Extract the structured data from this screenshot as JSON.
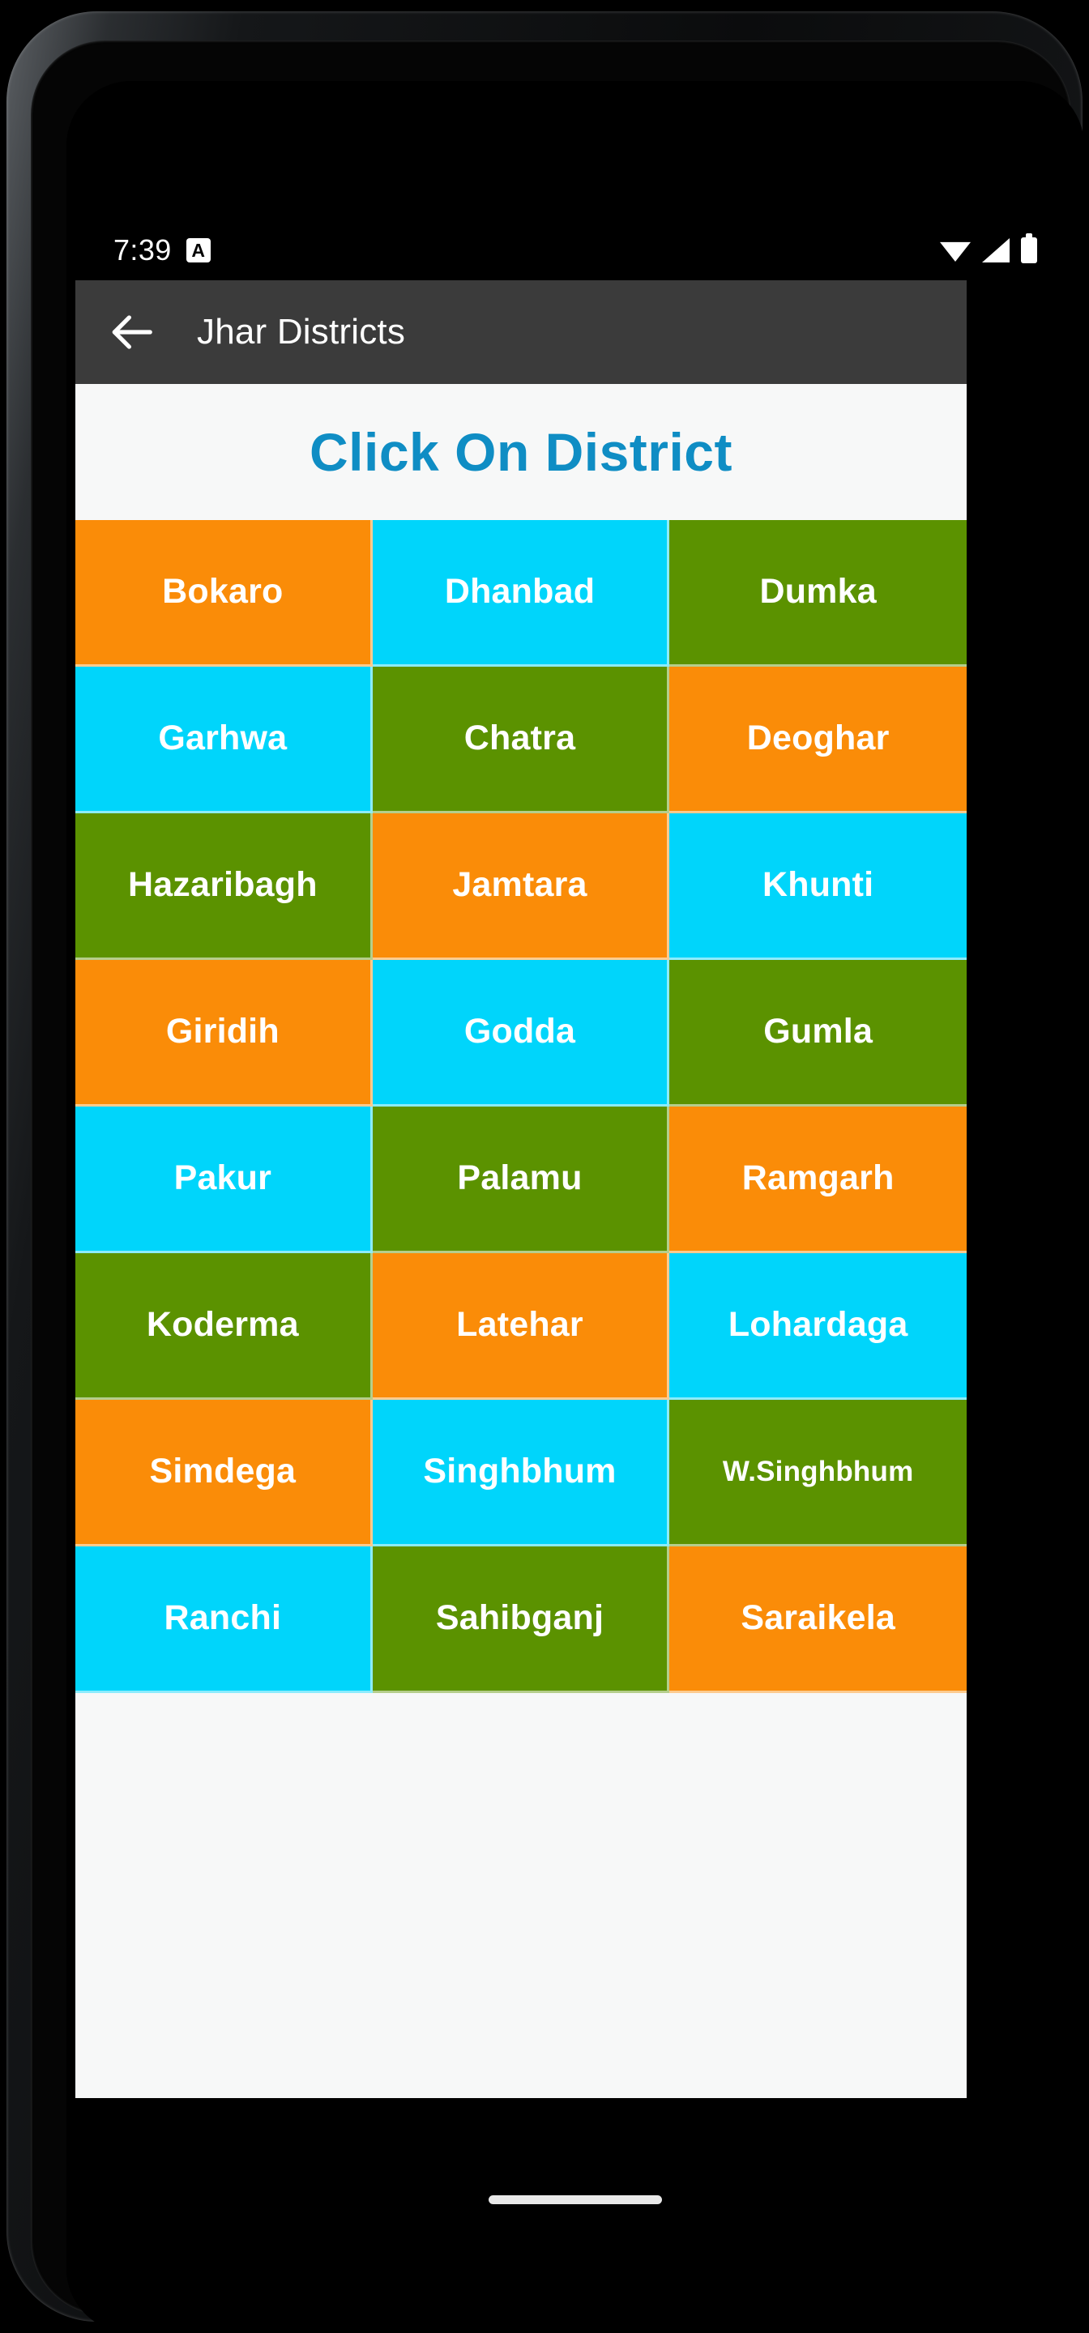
{
  "status_bar": {
    "time": "7:39",
    "notification_icon": "notification-a-icon",
    "notification_label": "A",
    "right_icons": [
      "wifi-icon",
      "cellular-signal-icon",
      "battery-full-icon"
    ]
  },
  "app_bar": {
    "back_icon": "back-arrow-icon",
    "title": "Jhar Districts",
    "background_color": "#3b3b3b"
  },
  "page": {
    "heading": "Click On District",
    "heading_color": "#0f8dc4",
    "background_color": "#f7f8f8"
  },
  "colors": {
    "orange": "#fa8c08",
    "cyan": "#00d5fb",
    "green": "#5b9200",
    "text": "#ffffff"
  },
  "districts": [
    {
      "label": "Bokaro",
      "color": "#fa8c08",
      "small": false
    },
    {
      "label": "Dhanbad",
      "color": "#00d5fb",
      "small": false
    },
    {
      "label": "Dumka",
      "color": "#5b9200",
      "small": false
    },
    {
      "label": "Garhwa",
      "color": "#00d5fb",
      "small": false
    },
    {
      "label": "Chatra",
      "color": "#5b9200",
      "small": false
    },
    {
      "label": "Deoghar",
      "color": "#fa8c08",
      "small": false
    },
    {
      "label": "Hazaribagh",
      "color": "#5b9200",
      "small": false
    },
    {
      "label": "Jamtara",
      "color": "#fa8c08",
      "small": false
    },
    {
      "label": "Khunti",
      "color": "#00d5fb",
      "small": false
    },
    {
      "label": "Giridih",
      "color": "#fa8c08",
      "small": false
    },
    {
      "label": "Godda",
      "color": "#00d5fb",
      "small": false
    },
    {
      "label": "Gumla",
      "color": "#5b9200",
      "small": false
    },
    {
      "label": "Pakur",
      "color": "#00d5fb",
      "small": false
    },
    {
      "label": "Palamu",
      "color": "#5b9200",
      "small": false
    },
    {
      "label": "Ramgarh",
      "color": "#fa8c08",
      "small": false
    },
    {
      "label": "Koderma",
      "color": "#5b9200",
      "small": false
    },
    {
      "label": "Latehar",
      "color": "#fa8c08",
      "small": false
    },
    {
      "label": "Lohardaga",
      "color": "#00d5fb",
      "small": false
    },
    {
      "label": "Simdega",
      "color": "#fa8c08",
      "small": false
    },
    {
      "label": "Singhbhum",
      "color": "#00d5fb",
      "small": false
    },
    {
      "label": "W.Singhbhum",
      "color": "#5b9200",
      "small": true
    },
    {
      "label": "Ranchi",
      "color": "#00d5fb",
      "small": false
    },
    {
      "label": "Sahibganj",
      "color": "#5b9200",
      "small": false
    },
    {
      "label": "Saraikela",
      "color": "#fa8c08",
      "small": false
    }
  ],
  "navigation": {
    "home_indicator": "home-indicator"
  }
}
